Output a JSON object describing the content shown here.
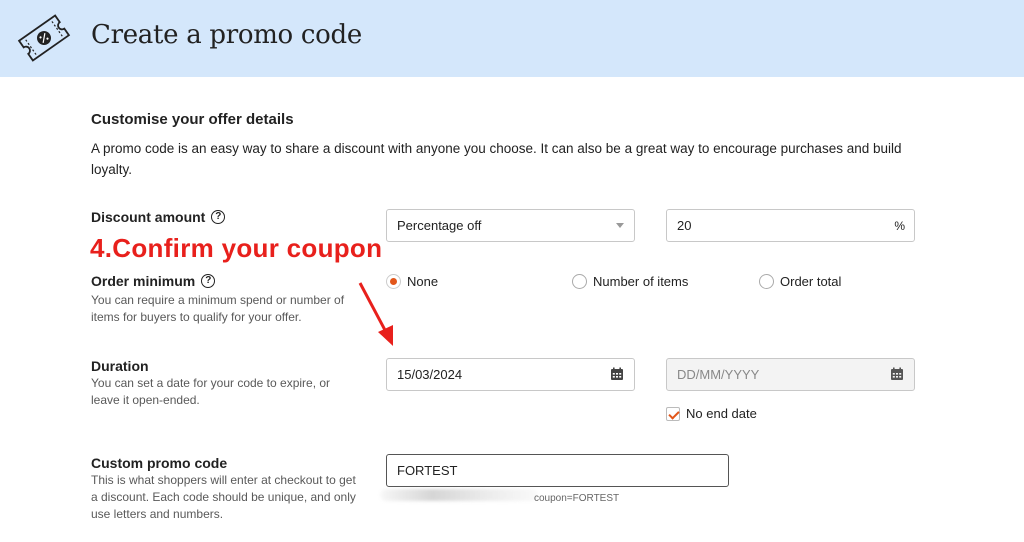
{
  "header": {
    "title": "Create a promo code",
    "icon": "ticket-percent-icon",
    "background": "#d4e7fb"
  },
  "offer": {
    "title": "Customise your offer details",
    "description": "A promo code is an easy way to share a discount with anyone you choose. It can also be a great way to encourage purchases and build loyalty."
  },
  "discount": {
    "label": "Discount amount",
    "type_value": "Percentage off",
    "amount_value": "20",
    "amount_suffix": "%"
  },
  "order_minimum": {
    "label": "Order minimum",
    "help": "You can require a minimum spend or number of items for buyers to qualify for your offer.",
    "options": [
      {
        "label": "None",
        "selected": true
      },
      {
        "label": "Number of items",
        "selected": false
      },
      {
        "label": "Order total",
        "selected": false
      }
    ]
  },
  "duration": {
    "label": "Duration",
    "help": "You can set a date for your code to expire, or leave it open-ended.",
    "start_date": "15/03/2024",
    "end_placeholder": "DD/MM/YYYY",
    "no_end_label": "No end date",
    "no_end_checked": true
  },
  "promo_code": {
    "label": "Custom promo code",
    "help": "This is what shoppers will enter at checkout to get a discount. Each code should be unique, and only use letters and numbers.",
    "value": "FORTEST",
    "url_suffix": "coupon=FORTEST"
  },
  "annotation": {
    "text": "4.Confirm your coupon",
    "color": "#e8201c"
  },
  "colors": {
    "accent": "#e2561a"
  }
}
